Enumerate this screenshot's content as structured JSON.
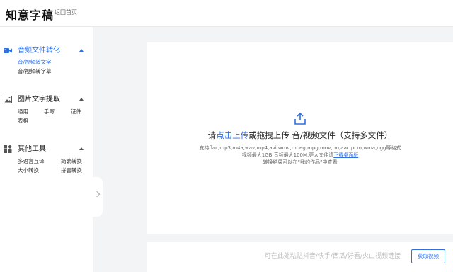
{
  "header": {
    "logo": "知意字稿",
    "back_link": "返回首页"
  },
  "sidebar": {
    "sections": [
      {
        "title": "音频文件转化",
        "icon": "video-camera-icon",
        "items": [
          "音/视频转文字",
          "音/视频转字幕"
        ]
      },
      {
        "title": "图片文字提取",
        "icon": "image-icon",
        "items": [
          "通用",
          "手写",
          "证件",
          "表格"
        ]
      },
      {
        "title": "其他工具",
        "icon": "apps-grid-icon",
        "items": [
          "多语言互译",
          "简繁转换",
          "大小转换",
          "拼音转换"
        ]
      }
    ]
  },
  "upload": {
    "prefix": "请",
    "click_link": "点击上传",
    "suffix": "或拖拽上传 音/视频文件（支持多文件）",
    "formats": "支持flac,mp3,m4a,wav,mp4,avi,wmv,mpeg,mpg,mov,rm,aac,pcm,wma,ogg等格式",
    "limits": "视频最大1GB,音频最大100M,更大文件请",
    "download_client": "下载桌面版",
    "result_hint": "转换结果可以在“我的作品”中查看"
  },
  "linkbar": {
    "placeholder": "可在此处粘贴抖音/快手/西瓜/好看/火山视频链接",
    "button": "获取视频"
  },
  "colors": {
    "accent": "#2f6fe0",
    "background": "#f3f4f6"
  }
}
